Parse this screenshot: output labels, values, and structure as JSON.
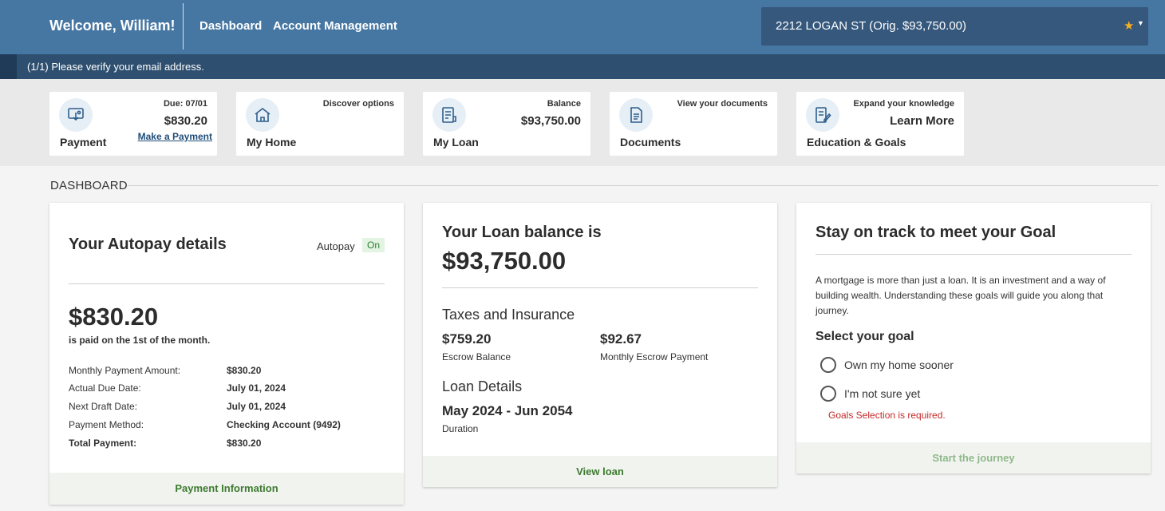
{
  "header": {
    "welcome": "Welcome, William!",
    "nav": [
      "Dashboard",
      "Account Management"
    ],
    "loan_selector": "2212 LOGAN ST (Orig. $93,750.00)",
    "favorite_icon": "star-icon",
    "dropdown_icon": "caret-down-icon"
  },
  "notice": {
    "text": "(1/1) Please verify your email address."
  },
  "tiles": {
    "payment": {
      "title": "Payment",
      "sub": "Due: 07/01",
      "value": "$830.20",
      "link": "Make a Payment"
    },
    "home": {
      "title": "My Home",
      "sub": "Discover options"
    },
    "loan": {
      "title": "My Loan",
      "sub": "Balance",
      "value": "$93,750.00"
    },
    "documents": {
      "title": "Documents",
      "sub": "View your documents"
    },
    "education": {
      "title": "Education & Goals",
      "sub": "Expand your knowledge",
      "value": "Learn More"
    }
  },
  "dashboard": {
    "title": "DASHBOARD"
  },
  "autopay": {
    "heading": "Your Autopay details",
    "autopay_label": "Autopay",
    "autopay_status": "On",
    "amount": "$830.20",
    "paid_note": "is paid on the 1st of the month.",
    "rows": [
      {
        "label": "Monthly Payment Amount:",
        "value": "$830.20"
      },
      {
        "label": "Actual Due Date:",
        "value": "July 01, 2024"
      },
      {
        "label": "Next Draft Date:",
        "value": "July 01, 2024"
      },
      {
        "label": "Payment Method:",
        "value": "Checking Account (9492)"
      },
      {
        "label": "Total Payment:",
        "value": "$830.20"
      }
    ],
    "footer": "Payment Information"
  },
  "loan_balance": {
    "heading": "Your Loan balance is",
    "balance": "$93,750.00",
    "taxes_heading": "Taxes and Insurance",
    "escrow_balance": "$759.20",
    "escrow_balance_label": "Escrow Balance",
    "monthly_escrow": "$92.67",
    "monthly_escrow_label": "Monthly Escrow Payment",
    "details_heading": "Loan Details",
    "duration": "May 2024 - Jun 2054",
    "duration_label": "Duration",
    "footer": "View loan"
  },
  "goal": {
    "heading": "Stay on track to meet your Goal",
    "description": "A mortgage is more than just a loan. It is an investment and a way of building wealth. Understanding these goals will guide you along that journey.",
    "select_label": "Select your goal",
    "options": [
      "Own my home sooner",
      "I'm not sure yet"
    ],
    "error": "Goals Selection is required.",
    "footer": "Start the journey"
  },
  "colors": {
    "nav_bg": "#4676a2",
    "notice_bg": "#2e4f6f",
    "accent_green": "#3d7a2f",
    "error_red": "#c62828",
    "star": "#f5b21f"
  }
}
